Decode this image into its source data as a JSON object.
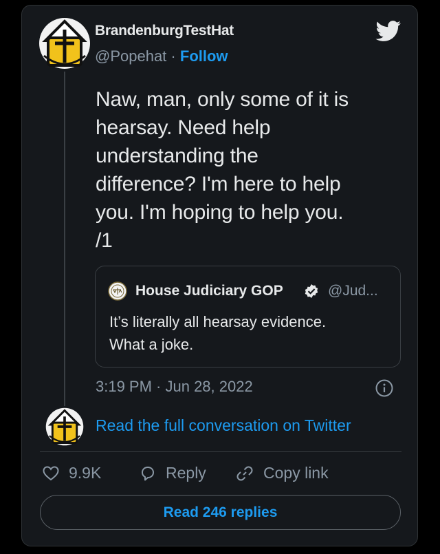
{
  "author": {
    "name": "BrandenburgTestHat",
    "handle": "@Popehat",
    "separator": "·",
    "follow_label": "Follow"
  },
  "tweet": {
    "text": "Naw, man, only some of it is\nhearsay.  Need help\nunderstanding the\ndifference?  I'm here to help\nyou.  I'm hoping to help you.\n/1"
  },
  "quoted_tweet": {
    "author_name": "House Judiciary GOP",
    "handle": "@Jud...",
    "text": "It’s literally all hearsay evidence.\nWhat a joke."
  },
  "timestamp": "3:19 PM · Jun 28, 2022",
  "read_conversation_label": "Read the full conversation on Twitter",
  "actions": {
    "likes_count": "9.9K",
    "reply_label": "Reply",
    "copy_link_label": "Copy link"
  },
  "read_replies_label": "Read 246 replies",
  "colors": {
    "background": "#000000",
    "card": "#15181c",
    "accent": "#1d9bf0",
    "text": "#e7e9ea",
    "muted": "#8b98a5"
  },
  "icons": [
    "twitter-bird-icon",
    "verified-badge-icon",
    "info-icon",
    "heart-icon",
    "reply-bubble-icon",
    "link-icon"
  ]
}
